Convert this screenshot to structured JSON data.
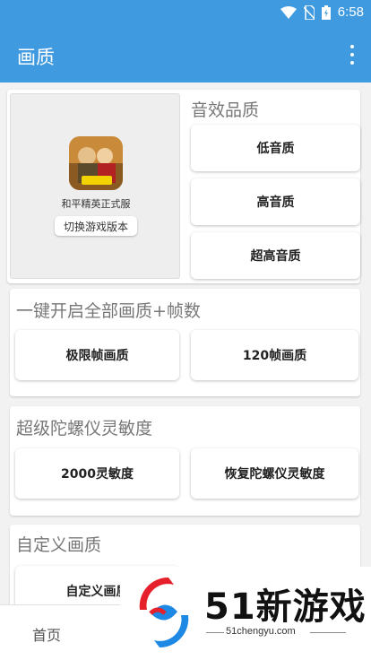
{
  "status_bar": {
    "time": "6:58"
  },
  "app_bar": {
    "title": "画质"
  },
  "game": {
    "name": "和平精英正式服",
    "switch_label": "切换游戏版本"
  },
  "audio": {
    "title": "音效品质",
    "buttons": [
      "低音质",
      "高音质",
      "超高音质"
    ]
  },
  "one_key": {
    "title": "一键开启全部画质+帧数",
    "buttons": [
      "极限帧画质",
      "120帧画质"
    ]
  },
  "gyro": {
    "title": "超级陀螺仪灵敏度",
    "buttons": [
      "2000灵敏度",
      "恢复陀螺仪灵敏度"
    ]
  },
  "custom": {
    "title": "自定义画质",
    "buttons": [
      "自定义画质"
    ]
  },
  "bottom_nav": {
    "home": "首页"
  },
  "watermark": {
    "brand": "51新游戏",
    "url": "51chengyu.com"
  },
  "colors": {
    "primary": "#3f9ae0"
  }
}
